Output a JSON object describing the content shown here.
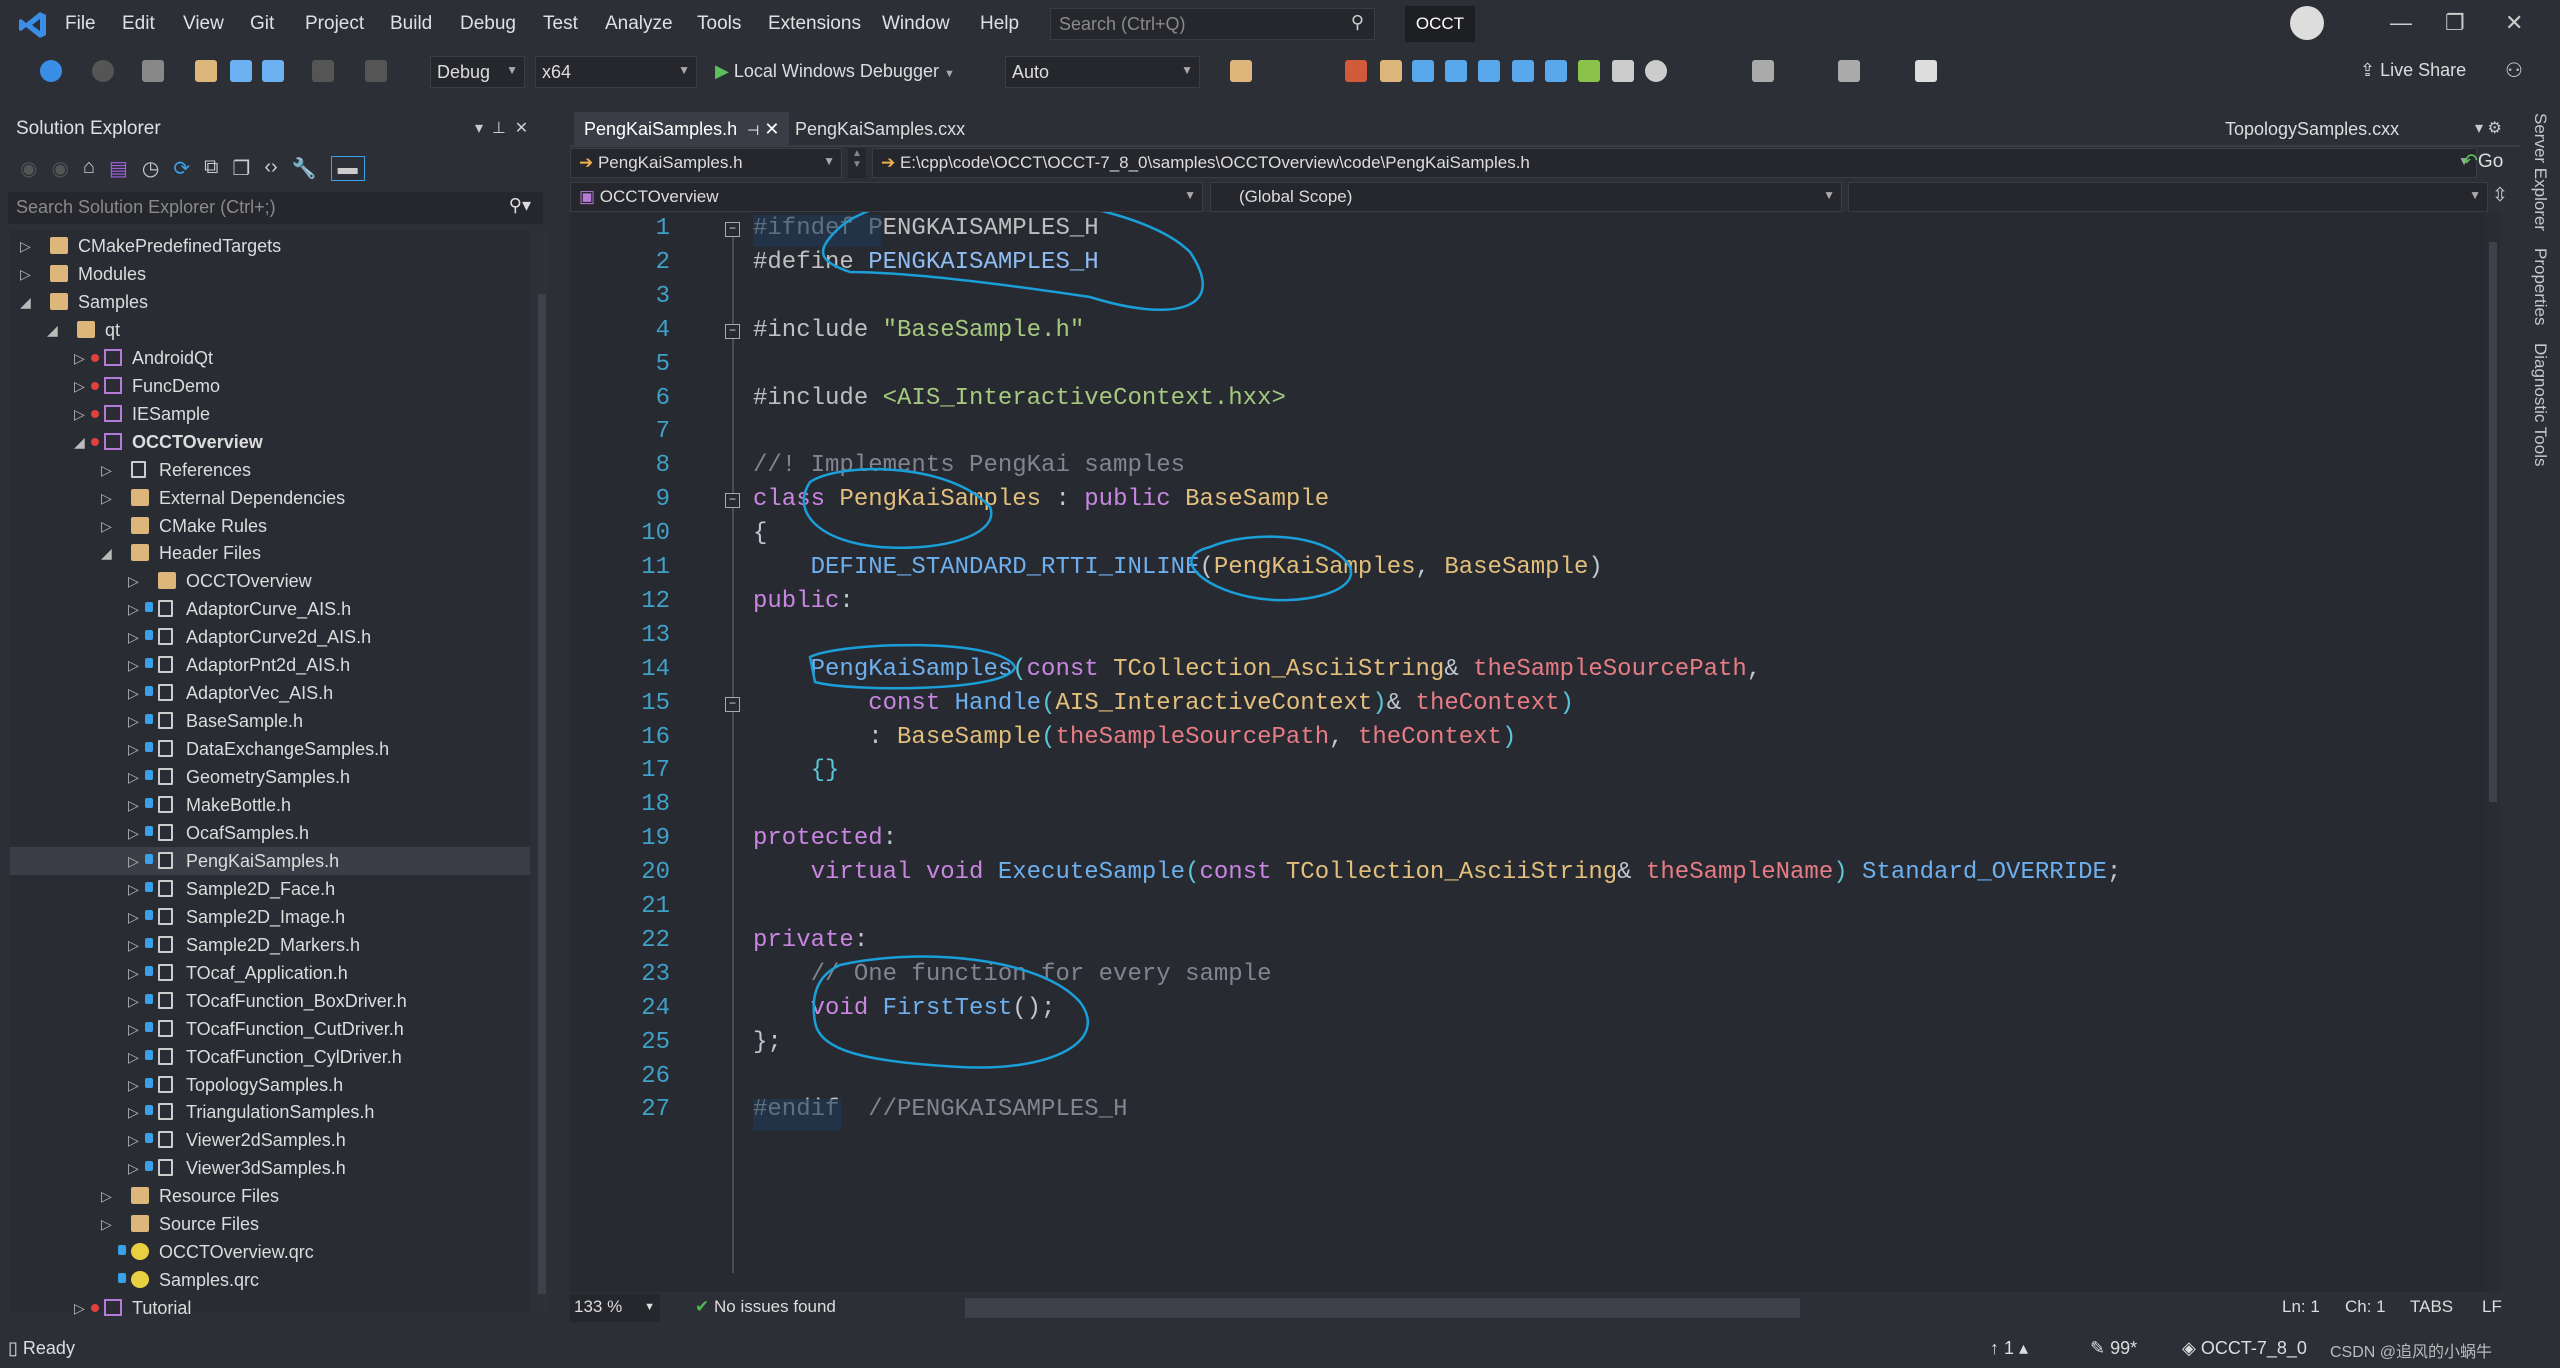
{
  "menu": {
    "items": [
      "File",
      "Edit",
      "View",
      "Git",
      "Project",
      "Build",
      "Debug",
      "Test",
      "Analyze",
      "Tools",
      "Extensions",
      "Window",
      "Help"
    ],
    "search_placeholder": "Search (Ctrl+Q)",
    "solution_badge": "OCCT"
  },
  "toolbar": {
    "config": "Debug",
    "platform": "x64",
    "run_label": "Local Windows Debugger",
    "auto": "Auto",
    "live_share": "Live Share"
  },
  "solution_explorer": {
    "title": "Solution Explorer",
    "search_placeholder": "Search Solution Explorer (Ctrl+;)",
    "items": [
      {
        "label": "CMakePredefinedTargets",
        "level": 0,
        "icon": "folder",
        "state": "collapsed"
      },
      {
        "label": "Modules",
        "level": 0,
        "icon": "folder",
        "state": "collapsed"
      },
      {
        "label": "Samples",
        "level": 0,
        "icon": "folder-open",
        "state": "expanded"
      },
      {
        "label": "qt",
        "level": 1,
        "icon": "folder-open",
        "state": "expanded"
      },
      {
        "label": "AndroidQt",
        "level": 2,
        "icon": "project",
        "state": "collapsed",
        "error": true
      },
      {
        "label": "FuncDemo",
        "level": 2,
        "icon": "project",
        "state": "collapsed",
        "error": true
      },
      {
        "label": "IESample",
        "level": 2,
        "icon": "project",
        "state": "collapsed",
        "error": true
      },
      {
        "label": "OCCTOverview",
        "level": 2,
        "icon": "project",
        "state": "expanded",
        "error": true,
        "bold": true
      },
      {
        "label": "References",
        "level": 3,
        "icon": "references",
        "state": "collapsed"
      },
      {
        "label": "External Dependencies",
        "level": 3,
        "icon": "folder",
        "state": "collapsed"
      },
      {
        "label": "CMake Rules",
        "level": 3,
        "icon": "filter",
        "state": "collapsed"
      },
      {
        "label": "Header Files",
        "level": 3,
        "icon": "filter",
        "state": "expanded"
      },
      {
        "label": "OCCTOverview",
        "level": 4,
        "icon": "filter",
        "state": "collapsed"
      },
      {
        "label": "AdaptorCurve_AIS.h",
        "level": 4,
        "icon": "header",
        "state": "collapsed",
        "lock": true
      },
      {
        "label": "AdaptorCurve2d_AIS.h",
        "level": 4,
        "icon": "header",
        "state": "collapsed",
        "lock": true
      },
      {
        "label": "AdaptorPnt2d_AIS.h",
        "level": 4,
        "icon": "header",
        "state": "collapsed",
        "lock": true
      },
      {
        "label": "AdaptorVec_AIS.h",
        "level": 4,
        "icon": "header",
        "state": "collapsed",
        "lock": true
      },
      {
        "label": "BaseSample.h",
        "level": 4,
        "icon": "header",
        "state": "collapsed",
        "lock": true
      },
      {
        "label": "DataExchangeSamples.h",
        "level": 4,
        "icon": "header",
        "state": "collapsed",
        "lock": true
      },
      {
        "label": "GeometrySamples.h",
        "level": 4,
        "icon": "header",
        "state": "collapsed",
        "lock": true
      },
      {
        "label": "MakeBottle.h",
        "level": 4,
        "icon": "header",
        "state": "collapsed",
        "lock": true
      },
      {
        "label": "OcafSamples.h",
        "level": 4,
        "icon": "header",
        "state": "collapsed",
        "lock": true
      },
      {
        "label": "PengKaiSamples.h",
        "level": 4,
        "icon": "header",
        "state": "collapsed",
        "lock": true,
        "selected": true
      },
      {
        "label": "Sample2D_Face.h",
        "level": 4,
        "icon": "header",
        "state": "collapsed",
        "lock": true
      },
      {
        "label": "Sample2D_Image.h",
        "level": 4,
        "icon": "header",
        "state": "collapsed",
        "lock": true
      },
      {
        "label": "Sample2D_Markers.h",
        "level": 4,
        "icon": "header",
        "state": "collapsed",
        "lock": true
      },
      {
        "label": "TOcaf_Application.h",
        "level": 4,
        "icon": "header",
        "state": "collapsed",
        "lock": true
      },
      {
        "label": "TOcafFunction_BoxDriver.h",
        "level": 4,
        "icon": "header",
        "state": "collapsed",
        "lock": true
      },
      {
        "label": "TOcafFunction_CutDriver.h",
        "level": 4,
        "icon": "header",
        "state": "collapsed",
        "lock": true
      },
      {
        "label": "TOcafFunction_CylDriver.h",
        "level": 4,
        "icon": "header",
        "state": "collapsed",
        "lock": true
      },
      {
        "label": "TopologySamples.h",
        "level": 4,
        "icon": "header",
        "state": "collapsed",
        "lock": true
      },
      {
        "label": "TriangulationSamples.h",
        "level": 4,
        "icon": "header",
        "state": "collapsed",
        "lock": true
      },
      {
        "label": "Viewer2dSamples.h",
        "level": 4,
        "icon": "header",
        "state": "collapsed",
        "lock": true
      },
      {
        "label": "Viewer3dSamples.h",
        "level": 4,
        "icon": "header",
        "state": "collapsed",
        "lock": true
      },
      {
        "label": "Resource Files",
        "level": 3,
        "icon": "filter",
        "state": "collapsed"
      },
      {
        "label": "Source Files",
        "level": 3,
        "icon": "filter",
        "state": "collapsed"
      },
      {
        "label": "OCCTOverview.qrc",
        "level": 3,
        "icon": "qrc",
        "state": "none",
        "lock": true
      },
      {
        "label": "Samples.qrc",
        "level": 3,
        "icon": "qrc",
        "state": "none",
        "lock": true
      },
      {
        "label": "Tutorial",
        "level": 2,
        "icon": "project",
        "state": "collapsed",
        "error": true
      }
    ]
  },
  "tabs": [
    {
      "label": "PengKaiSamples.h",
      "active": true
    },
    {
      "label": "PengKaiSamples.cxx",
      "active": false
    }
  ],
  "tab_overflow": "TopologySamples.cxx",
  "nav": {
    "file": "PengKaiSamples.h",
    "path": "E:\\cpp\\code\\OCCT\\OCCT-7_8_0\\samples\\OCCTOverview\\code\\PengKaiSamples.h",
    "go": "Go",
    "project": "OCCTOverview",
    "scope": "(Global Scope)",
    "member": ""
  },
  "code": [
    [
      [
        "pp",
        "#ifndef "
      ],
      [
        "pp",
        "PENGKAISAMPLES_H"
      ]
    ],
    [
      [
        "pp",
        "#define "
      ],
      [
        "mac",
        "PENGKAISAMPLES_H"
      ]
    ],
    [],
    [
      [
        "pp",
        "#include "
      ],
      [
        "str",
        "\"BaseSample.h\""
      ]
    ],
    [],
    [
      [
        "pp",
        "#include "
      ],
      [
        "str",
        "<AIS_InteractiveContext.hxx>"
      ]
    ],
    [],
    [
      [
        "cm",
        "//! Implements PengKai samples"
      ]
    ],
    [
      [
        "kw",
        "class "
      ],
      [
        "type",
        "PengKaiSamples"
      ],
      [
        "p",
        " : "
      ],
      [
        "kw",
        "public "
      ],
      [
        "type",
        "BaseSample"
      ]
    ],
    [
      [
        "p",
        "{"
      ]
    ],
    [
      [
        "p",
        "    "
      ],
      [
        "fn",
        "DEFINE_STANDARD_RTTI_INLINE"
      ],
      [
        "p",
        "("
      ],
      [
        "type",
        "PengKaiSamples"
      ],
      [
        "p",
        ", "
      ],
      [
        "type",
        "BaseSample"
      ],
      [
        "p",
        ")"
      ]
    ],
    [
      [
        "kw",
        "public"
      ],
      [
        "p",
        ":"
      ]
    ],
    [],
    [
      [
        "p",
        "    "
      ],
      [
        "fn",
        "PengKaiSamples"
      ],
      [
        "br",
        "("
      ],
      [
        "kw",
        "const "
      ],
      [
        "type",
        "TCollection_AsciiString"
      ],
      [
        "p",
        "& "
      ],
      [
        "par",
        "theSampleSourcePath"
      ],
      [
        "p",
        ","
      ]
    ],
    [
      [
        "p",
        "        "
      ],
      [
        "kw",
        "const "
      ],
      [
        "fn",
        "Handle"
      ],
      [
        "br",
        "("
      ],
      [
        "type",
        "AIS_InteractiveContext"
      ],
      [
        "br",
        ")"
      ],
      [
        "p",
        "& "
      ],
      [
        "par",
        "theContext"
      ],
      [
        "br",
        ")"
      ]
    ],
    [
      [
        "p",
        "        : "
      ],
      [
        "type",
        "BaseSample"
      ],
      [
        "br",
        "("
      ],
      [
        "par",
        "theSampleSourcePath"
      ],
      [
        "p",
        ", "
      ],
      [
        "par",
        "theContext"
      ],
      [
        "br",
        ")"
      ]
    ],
    [
      [
        "br",
        "    {}"
      ]
    ],
    [],
    [
      [
        "kw",
        "protected"
      ],
      [
        "p",
        ":"
      ]
    ],
    [
      [
        "p",
        "    "
      ],
      [
        "kw",
        "virtual void "
      ],
      [
        "fn",
        "ExecuteSample"
      ],
      [
        "br",
        "("
      ],
      [
        "kw",
        "const "
      ],
      [
        "type",
        "TCollection_AsciiString"
      ],
      [
        "p",
        "& "
      ],
      [
        "par",
        "theSampleName"
      ],
      [
        "br",
        ")"
      ],
      [
        "p",
        " "
      ],
      [
        "fn",
        "Standard_OVERRIDE"
      ],
      [
        "p",
        ";"
      ]
    ],
    [],
    [
      [
        "kw",
        "private"
      ],
      [
        "p",
        ":"
      ]
    ],
    [
      [
        "cm",
        "    // One function for every sample"
      ]
    ],
    [
      [
        "p",
        "    "
      ],
      [
        "kw",
        "void "
      ],
      [
        "fn",
        "FirstTest"
      ],
      [
        "p",
        "();"
      ]
    ],
    [
      [
        "p",
        "};"
      ]
    ],
    [],
    [
      [
        "pp",
        "#endif"
      ],
      [
        "cm",
        "  //PENGKAISAMPLES_H"
      ]
    ]
  ],
  "editor_bottom": {
    "zoom": "133 %",
    "issues": "No issues found",
    "line": "Ln: 1",
    "col": "Ch: 1",
    "indent": "TABS",
    "eol": "LF"
  },
  "right_strip": [
    "Server Explorer",
    "Properties",
    "Diagnostic Tools"
  ],
  "status": {
    "ready": "Ready",
    "up": "1",
    "pencil": "99*",
    "branch": "OCCT-7_8_0",
    "watermark": "CSDN @追风的小蜗牛"
  },
  "colors": {
    "accent": "#3aa0e8",
    "background": "#282a32",
    "annotation": "#1a9fd8"
  }
}
